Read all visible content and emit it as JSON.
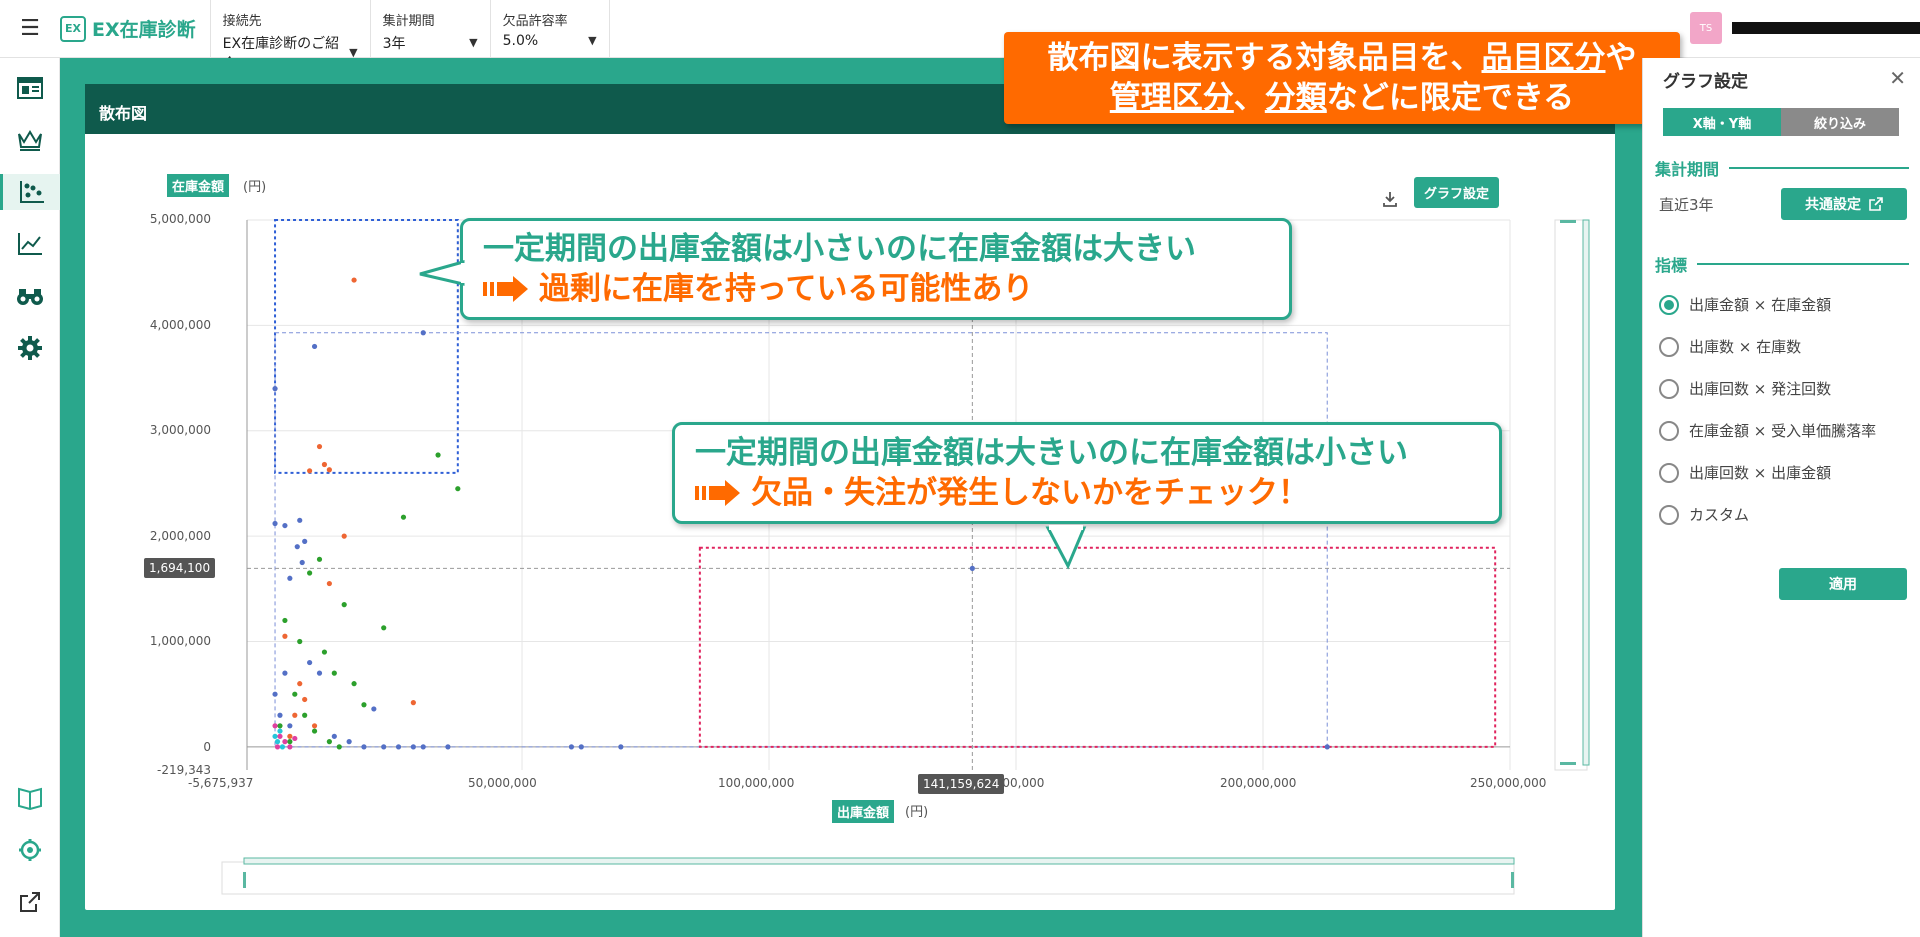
{
  "header": {
    "logo_text": "EX在庫診断",
    "logo_mark": "EX",
    "connection": {
      "label": "接続先",
      "value": "EX在庫診断のご紹介"
    },
    "period": {
      "label": "集計期間",
      "value": "3年"
    },
    "tolerance": {
      "label": "欠品許容率",
      "value": "5.0%"
    },
    "user_initials": "TS"
  },
  "card": {
    "title": "散布図",
    "graph_settings_button": "グラフ設定"
  },
  "chart_data": {
    "type": "scatter",
    "title": "散布図",
    "xlabel": "出庫金額",
    "xunit": "(円)",
    "ylabel": "在庫金額",
    "yunit": "(円)",
    "xlim": [
      -5675937,
      250000000
    ],
    "ylim": [
      -219343,
      5000000
    ],
    "x_ticks": [
      "-5,675,937",
      "50,000,000",
      "100,000,000",
      "150,000,000",
      "200,000,000",
      "250,000,000"
    ],
    "y_ticks": [
      "5,000,000",
      "4,000,000",
      "3,000,000",
      "2,000,000",
      "1,000,000",
      "0",
      "-219,343"
    ],
    "crosshair": {
      "x": 141159624,
      "y": 1694100,
      "x_label": "141,159,624",
      "y_label": "1,694,100"
    },
    "grid": true,
    "series": [
      {
        "color": "#5470c6",
        "points": [
          [
            0,
            3400000
          ],
          [
            8000000,
            3800000
          ],
          [
            30000000,
            3930000
          ],
          [
            0,
            2120000
          ],
          [
            5000000,
            2150000
          ],
          [
            6000000,
            1950000
          ],
          [
            4500000,
            1900000
          ],
          [
            5500000,
            1750000
          ],
          [
            3000000,
            1600000
          ],
          [
            2000000,
            2100000
          ],
          [
            20000000,
            360000
          ],
          [
            22000000,
            0
          ],
          [
            25000000,
            0
          ],
          [
            28000000,
            0
          ],
          [
            30000000,
            0
          ],
          [
            60000000,
            0
          ],
          [
            62000000,
            0
          ],
          [
            70000000,
            0
          ],
          [
            141159624,
            1694100
          ],
          [
            213000000,
            0
          ],
          [
            0,
            500000
          ],
          [
            2000000,
            700000
          ],
          [
            7000000,
            800000
          ],
          [
            9000000,
            700000
          ],
          [
            1000000,
            300000
          ],
          [
            3000000,
            200000
          ],
          [
            12000000,
            100000
          ],
          [
            15000000,
            50000
          ],
          [
            18000000,
            0
          ],
          [
            35000000,
            0
          ]
        ]
      },
      {
        "color": "#ee6633",
        "points": [
          [
            16000000,
            4430000
          ],
          [
            9000000,
            2850000
          ],
          [
            10000000,
            2680000
          ],
          [
            11000000,
            2630000
          ],
          [
            7000000,
            2620000
          ],
          [
            14000000,
            2000000
          ],
          [
            11000000,
            1550000
          ],
          [
            2000000,
            1050000
          ],
          [
            5000000,
            600000
          ],
          [
            6000000,
            450000
          ],
          [
            28000000,
            420000
          ],
          [
            4000000,
            300000
          ],
          [
            8000000,
            200000
          ],
          [
            3000000,
            100000
          ]
        ]
      },
      {
        "color": "#2ca02c",
        "points": [
          [
            33000000,
            2770000
          ],
          [
            37000000,
            2450000
          ],
          [
            26000000,
            2180000
          ],
          [
            9000000,
            1780000
          ],
          [
            7000000,
            1650000
          ],
          [
            14000000,
            1350000
          ],
          [
            22000000,
            1130000
          ],
          [
            2000000,
            1200000
          ],
          [
            5000000,
            1000000
          ],
          [
            10000000,
            900000
          ],
          [
            12000000,
            700000
          ],
          [
            16000000,
            600000
          ],
          [
            18000000,
            400000
          ],
          [
            4000000,
            500000
          ],
          [
            6000000,
            300000
          ],
          [
            1000000,
            200000
          ],
          [
            8000000,
            150000
          ],
          [
            3000000,
            50000
          ],
          [
            11000000,
            50000
          ],
          [
            13000000,
            0
          ]
        ]
      },
      {
        "color": "#e040a0",
        "points": [
          [
            0,
            200000
          ],
          [
            1000000,
            100000
          ],
          [
            2000000,
            50000
          ],
          [
            500000,
            0
          ],
          [
            3000000,
            0
          ],
          [
            4000000,
            80000
          ]
        ]
      },
      {
        "color": "#26c6da",
        "points": [
          [
            0,
            100000
          ],
          [
            500000,
            50000
          ],
          [
            1500000,
            0
          ],
          [
            1000000,
            150000
          ]
        ]
      }
    ]
  },
  "callouts": {
    "green_top_line1": "一定期間の出庫金額は小さいのに在庫金額は大きい",
    "green_top_line2": "過剰に在庫を持っている可能性あり",
    "green_bottom_line1": "一定期間の出庫金額は大きいのに在庫金額は小さい",
    "green_bottom_line2": "欠品・失注が発生しないかをチェック！",
    "orange_part1": "散布図に表示する対象品目を、",
    "orange_u1": "品目区分",
    "orange_part2": "や",
    "orange_u2": "管理区分",
    "orange_part3": "、",
    "orange_u3": "分類",
    "orange_part4": "などに限定できる"
  },
  "right_panel": {
    "title": "グラフ設定",
    "tab_xy": "X軸・Y軸",
    "tab_filter": "絞り込み",
    "section_period": "集計期間",
    "period_value": "直近3年",
    "common_settings_button": "共通設定",
    "section_metric": "指標",
    "metrics": [
      {
        "label": "出庫金額 × 在庫金額",
        "checked": true
      },
      {
        "label": "出庫数 × 在庫数",
        "checked": false
      },
      {
        "label": "出庫回数 × 発注回数",
        "checked": false
      },
      {
        "label": "在庫金額 × 受入単価騰落率",
        "checked": false
      },
      {
        "label": "出庫回数 × 出庫金額",
        "checked": false
      },
      {
        "label": "カスタム",
        "checked": false
      }
    ],
    "apply_button": "適用"
  }
}
